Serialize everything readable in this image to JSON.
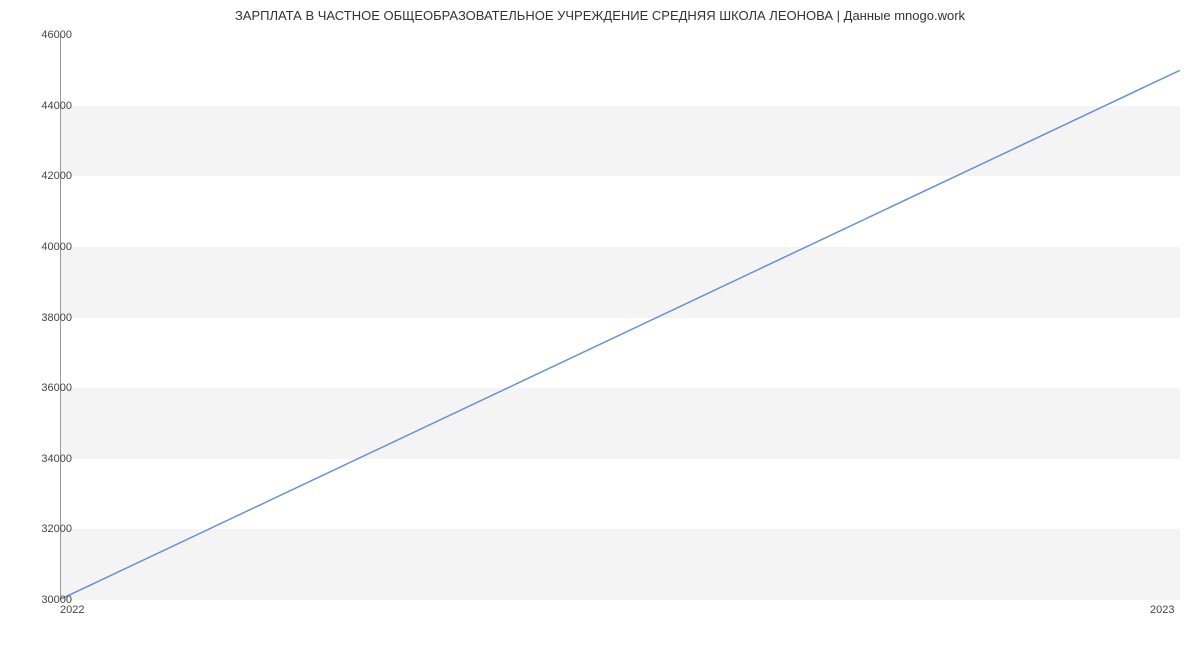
{
  "chart_data": {
    "type": "line",
    "title": "ЗАРПЛАТА В ЧАСТНОЕ ОБЩЕОБРАЗОВАТЕЛЬНОЕ УЧРЕЖДЕНИЕ СРЕДНЯЯ ШКОЛА ЛЕОНОВА | Данные mnogo.work",
    "x": [
      "2022",
      "2023"
    ],
    "values": [
      30000,
      45000
    ],
    "xlabel": "",
    "ylabel": "",
    "ylim": [
      30000,
      46000
    ],
    "yticks": [
      30000,
      32000,
      34000,
      36000,
      38000,
      40000,
      42000,
      44000,
      46000
    ],
    "xticks": [
      "2022",
      "2023"
    ],
    "line_color": "#6a8fd8"
  }
}
